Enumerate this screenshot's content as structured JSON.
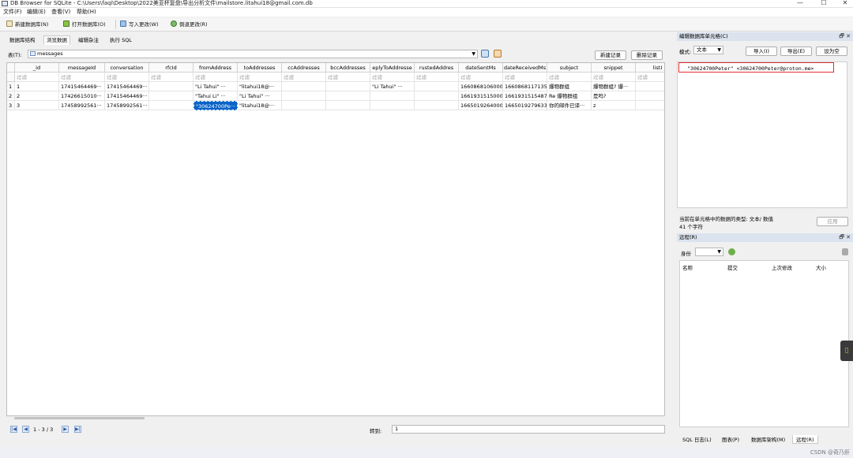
{
  "window": {
    "title": "DB Browser for SQLite - C:\\Users\\faqi\\Desktop\\2022美亚杯复盘\\导出分析文件\\mailstore.litahui18@gmail.com.db",
    "min_glyph": "—",
    "max_glyph": "☐",
    "close_glyph": "✕"
  },
  "menu": [
    "文件(F)",
    "编辑(E)",
    "查看(V)",
    "帮助(H)"
  ],
  "toolbar": {
    "new_db": "新建数据库(N)",
    "open_db": "打开数据库(O)",
    "write_changes": "写入更改(W)",
    "revert_changes": "倒退更改(R)"
  },
  "tabs": [
    "数据库结构",
    "浏览数据",
    "编辑杂注",
    "执行 SQL"
  ],
  "active_tab": 1,
  "table_bar": {
    "label": "表(T):",
    "table_name": "messages",
    "new_record": "新建记录",
    "delete_record": "删除记录"
  },
  "grid": {
    "columns": [
      "_id",
      "messageId",
      "conversation",
      "rfcId",
      "fromAddress",
      "toAddresses",
      "ccAddresses",
      "bccAddresses",
      "eplyToAddresse",
      "rustedAddres",
      "dateSentMs",
      "dateReceivedMs",
      "subject",
      "snippet",
      "listI"
    ],
    "filter_placeholder": "过滤",
    "rows": [
      {
        "num": "1",
        "cells": [
          "1",
          "17415464469···",
          "17415464469···",
          "",
          "\"Li Tahui\" ···",
          "\"litahui18@···",
          "",
          "",
          "\"Li Tahui\" ···",
          "",
          "1660868106000",
          "1660868117135",
          "爆物群组",
          "爆物群组? 爆···",
          ""
        ]
      },
      {
        "num": "2",
        "cells": [
          "2",
          "17426615010···",
          "17415464469···",
          "",
          "\"Tahui Li\" ···",
          "\"Li Tahui\" ···",
          "",
          "",
          "",
          "",
          "1661931515000",
          "1661931515487",
          "Re  爆物群组",
          "是吗?",
          ""
        ]
      },
      {
        "num": "3",
        "cells": [
          "3",
          "17458992561···",
          "17458992561···",
          "",
          "\"30624700Pe···",
          "\"litahui18@···",
          "",
          "",
          "",
          "",
          "1665019264000",
          "1665019279633",
          "你的邮件已译···",
          "z",
          ""
        ]
      }
    ],
    "selected_row": 2,
    "selected_col": 4
  },
  "nav": {
    "first": "|◀",
    "prev": "◀",
    "range": "1 - 3 / 3",
    "next": "▶",
    "last": "▶|",
    "goto_label": "转到:",
    "goto_value": "1"
  },
  "edit_panel": {
    "title": "编辑数据库单元格(C)",
    "title_icons": "🗗 ✕",
    "mode_label": "模式:",
    "mode_value": "文本",
    "import": "导入(I)",
    "export": "导出(E)",
    "set_null": "设为空",
    "cell_value": "\"30624700Peter\" <30624700Peter@proton.me>",
    "type_info": "当前在单元格中的数据的类型: 文本/ 数值",
    "char_count": "41 个字符",
    "apply": "应用"
  },
  "remote_panel": {
    "title": "远程(R)",
    "title_icons": "🗗 ✕",
    "identity_label": "身份",
    "columns": [
      "名称",
      "提交",
      "上次修改",
      "大小"
    ]
  },
  "bottom_tabs": [
    "SQL 日志(L)",
    "图表(P)",
    "数据库架构(M)",
    "远程(R)"
  ],
  "active_bottom_tab": 3,
  "watermark": "CSDN @奇乃肝"
}
